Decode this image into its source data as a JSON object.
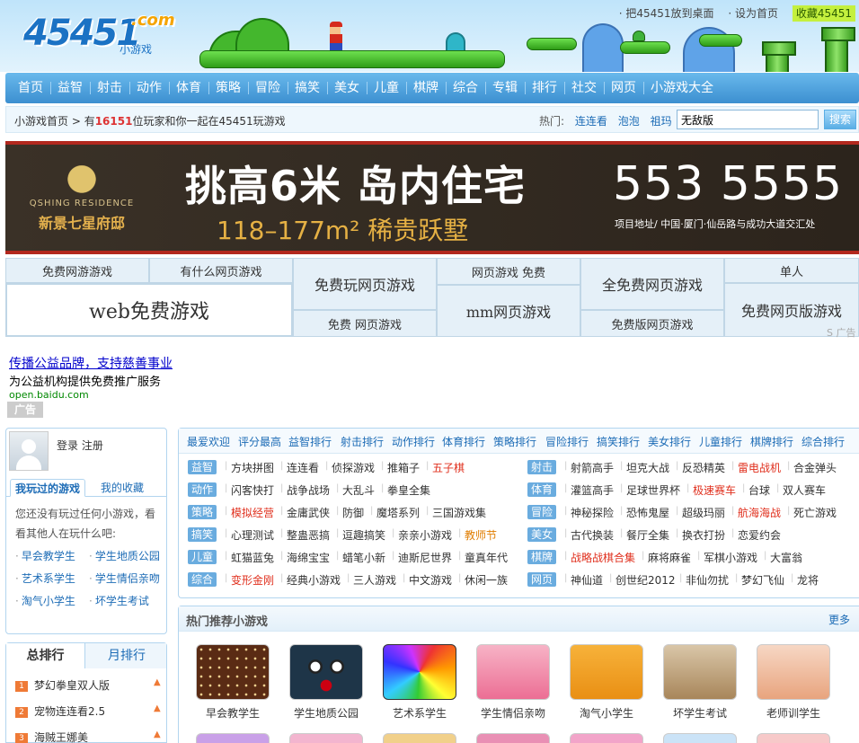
{
  "header": {
    "logo_text": "45451",
    "logo_dotcom": ".com",
    "logo_sub": "小游戏",
    "links": {
      "set_desktop": "· 把45451放到桌面",
      "set_home": "· 设为首页",
      "favorite": "收藏45451"
    }
  },
  "nav": {
    "items": [
      "首页",
      "益智",
      "射击",
      "动作",
      "体育",
      "策略",
      "冒险",
      "搞笑",
      "美女",
      "儿童",
      "棋牌",
      "综合",
      "专辑",
      "排行",
      "社交",
      "网页",
      "小游戏大全"
    ]
  },
  "breadcrumb": {
    "home": "小游戏首页",
    "sep": " > 有",
    "count": "16151",
    "suffix": "位玩家和你一起在45451玩游戏",
    "hot_label": "热门:",
    "hot_links": [
      "连连看",
      "泡泡",
      "祖玛"
    ],
    "search_value": "无敌版",
    "search_button": "搜索"
  },
  "banner": {
    "logo_en": "QSHING RESIDENCE",
    "logo_cn": "新景七星府邸",
    "headline": "挑高6米 岛内住宅",
    "sub": "118–177m² 稀贵跃墅",
    "phone": "553 5555",
    "address": "项目地址/  中国·厦门·仙岳路与成功大道交汇处"
  },
  "link_ads": {
    "a1": "免费网游游戏",
    "a2": "有什么网页游戏",
    "a3": "web免费游戏",
    "a4": "免费玩网页游戏",
    "a5": "免费 网页游戏",
    "a6": "网页游戏 免费",
    "a7": "mm网页游戏",
    "a8": "全免费网页游戏",
    "a9": "免费版网页游戏",
    "a10": "单人",
    "a11": "免费网页版游戏",
    "mark": "S 广告"
  },
  "text_ad": {
    "title": "传播公益品牌，支持慈善事业",
    "desc": "为公益机构提供免费推广服务",
    "url": "open.baidu.com",
    "tag": "广告"
  },
  "user": {
    "login": "登录 注册",
    "tab_played": "我玩过的游戏",
    "tab_fav": "我的收藏",
    "tip": "您还没有玩过任何小游戏，看看其他人在玩什么吧:",
    "links": [
      "早会教学生",
      "学生地质公园",
      "艺术系学生",
      "学生情侣亲吻",
      "淘气小学生",
      "坏学生考试"
    ]
  },
  "rank": {
    "tab_total": "总排行",
    "tab_month": "月排行",
    "items": [
      "梦幻拳皇双人版",
      "宠物连连看2.5",
      "海贼王娜美"
    ]
  },
  "categories": {
    "rank_links": [
      "最爱欢迎",
      "评分最高",
      "益智排行",
      "射击排行",
      "动作排行",
      "体育排行",
      "策略排行",
      "冒险排行",
      "搞笑排行",
      "美女排行",
      "儿童排行",
      "棋牌排行",
      "综合排行"
    ],
    "rows": [
      {
        "left_tag": "益智",
        "left": [
          "方块拼图",
          "连连看",
          "侦探游戏",
          "推箱子",
          "五子棋"
        ],
        "right_tag": "射击",
        "right": [
          "射箭高手",
          "坦克大战",
          "反恐精英",
          "雷电战机",
          "合金弹头"
        ]
      },
      {
        "left_tag": "动作",
        "left": [
          "闪客快打",
          "战争战场",
          "大乱斗",
          "拳皇全集"
        ],
        "right_tag": "体育",
        "right": [
          "灌篮高手",
          "足球世界杯",
          "极速赛车",
          "台球",
          "双人赛车"
        ]
      },
      {
        "left_tag": "策略",
        "left": [
          "模拟经营",
          "金庸武侠",
          "防御",
          "魔塔系列",
          "三国游戏集"
        ],
        "right_tag": "冒险",
        "right": [
          "神秘探险",
          "恐怖鬼屋",
          "超级玛丽",
          "航海海战",
          "死亡游戏"
        ]
      },
      {
        "left_tag": "搞笑",
        "left": [
          "心理测试",
          "整蛊恶搞",
          "逗趣搞笑",
          "亲亲小游戏",
          "教师节"
        ],
        "right_tag": "美女",
        "right": [
          "古代换装",
          "餐厅全集",
          "换衣打扮",
          "恋爱约会"
        ]
      },
      {
        "left_tag": "儿童",
        "left": [
          "虹猫蓝兔",
          "海绵宝宝",
          "蜡笔小新",
          "迪斯尼世界",
          "童真年代"
        ],
        "right_tag": "棋牌",
        "right": [
          "战略战棋合集",
          "麻将麻雀",
          "军棋小游戏",
          "大富翁"
        ]
      },
      {
        "left_tag": "综合",
        "left": [
          "变形金刚",
          "经典小游戏",
          "三人游戏",
          "中文游戏",
          "休闲一族"
        ],
        "right_tag": "网页",
        "right": [
          "神仙道",
          "创世纪2012",
          "非仙勿扰",
          "梦幻飞仙",
          "龙将"
        ]
      }
    ]
  },
  "hot": {
    "title": "热门推荐小游戏",
    "more": "更多",
    "games": [
      "早会教学生",
      "学生地质公园",
      "艺术系学生",
      "学生情侣亲吻",
      "淘气小学生",
      "坏学生考试",
      "老师训学生"
    ]
  },
  "colors": {
    "nav_top": "#69b9ec",
    "nav_bottom": "#3c8fd0",
    "link_blue": "#1d6cb6",
    "highlight_red": "#e0301e",
    "tag_blue": "#6aacdf",
    "banner_red": "#b2281e"
  }
}
